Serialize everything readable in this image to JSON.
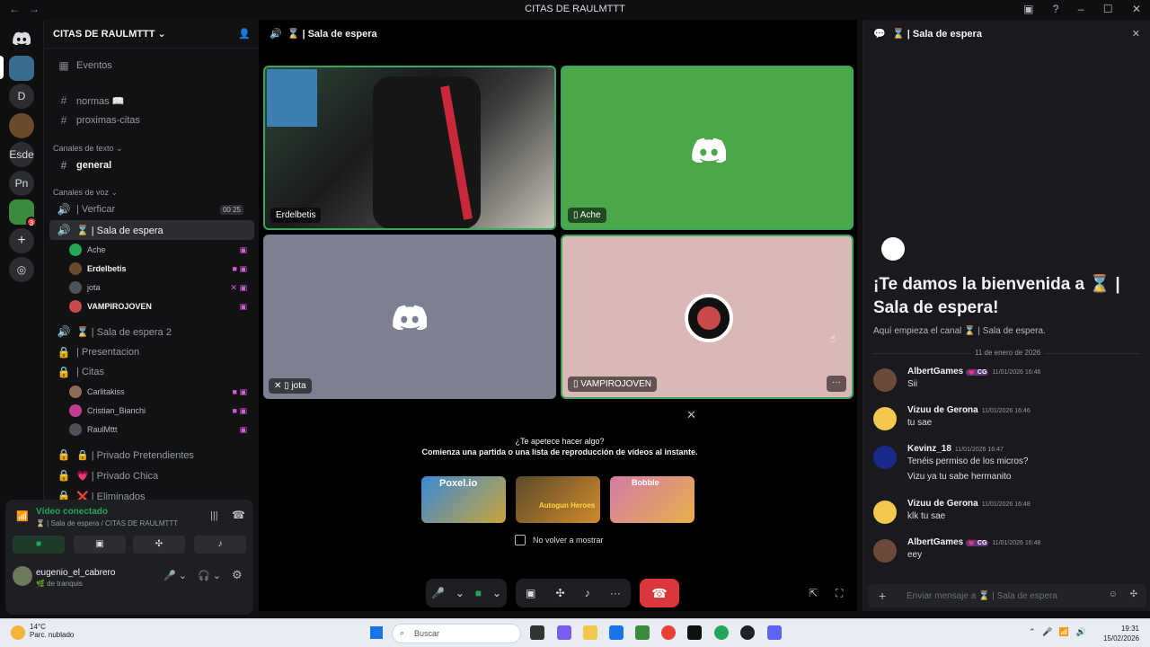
{
  "window": {
    "title": "CITAS DE RAULMTTT",
    "help": "?",
    "minimize": "–",
    "maximize": "☐",
    "close": "✕",
    "back": "←",
    "forward": "→"
  },
  "rail": {
    "servers": [
      "D",
      "Esde",
      "Pn"
    ],
    "badge": "3"
  },
  "server": {
    "name": "CITAS DE RAULMTTT ⌄"
  },
  "sidebar": {
    "events": "Eventos",
    "text_channels": [
      {
        "name": "normas 📖"
      },
      {
        "name": "proximas-citas"
      }
    ],
    "category_text": "Canales de texto ⌄",
    "general": "general",
    "category_voice": "Canales de voz ⌄",
    "voice_channels": [
      {
        "name": "| Verficar",
        "counter": "00  25"
      },
      {
        "name": "⌛ | Sala de espera"
      },
      {
        "name": "⌛ | Sala de espera 2"
      },
      {
        "name": "| Presentacion"
      },
      {
        "name": "| Citas"
      },
      {
        "name": "🔒 | Privado Pretendientes"
      },
      {
        "name": "💗 | Privado Chica"
      },
      {
        "name": "❌ | Eliminados"
      }
    ],
    "users_sala": [
      "Ache",
      "Erdelbetis",
      "jota",
      "VAMPIROJOVEN"
    ],
    "users_citas": [
      "Carlitakiss",
      "Cristian_Bianchi",
      "RaulMttt"
    ]
  },
  "voice_panel": {
    "status": "Vídeo conectado",
    "channel": "⌛ | Sala de espera / CITAS DE RAULMTTT",
    "username": "eugenio_el_cabrero",
    "user_status": "🌿 de tranquis"
  },
  "main": {
    "header": "⌛ | Sala de espera",
    "tiles": [
      "Erdelbetis",
      "Ache",
      "jota",
      "VAMPIROJOVEN"
    ],
    "activity_prompt": "¿Te apetece hacer algo?",
    "activity_desc": "Comienza una partida o una lista de reproducción de vídeos al instante.",
    "games": [
      "Poxel.io",
      "Autogun Heroes",
      "Bobble"
    ],
    "no_show": "No volver a mostrar",
    "close": "✕"
  },
  "chat": {
    "header": "⌛ | Sala de espera",
    "welcome": "¡Te damos la bienvenida a ⌛ | Sala de espera!",
    "welcome_sub": "Aquí empieza el canal ⌛ | Sala de espera.",
    "date_divider": "11 de enero de 2026",
    "messages": [
      {
        "author": "AlbertGames",
        "tag": "💗 CG",
        "time": "11/01/2026 16:46",
        "lines": [
          "Sii"
        ]
      },
      {
        "author": "Vizuu de Gerona",
        "tag": "",
        "time": "11/01/2026 16:46",
        "lines": [
          "tu sae"
        ]
      },
      {
        "author": "Kevinz_18",
        "tag": "",
        "time": "11/01/2026 16:47",
        "lines": [
          "Tenéis permiso de los micros?",
          "Vizu ya tu sabe hermanito"
        ]
      },
      {
        "author": "Vizuu de Gerona",
        "tag": "",
        "time": "11/01/2026 16:48",
        "lines": [
          "klk tu sae"
        ]
      },
      {
        "author": "AlbertGames",
        "tag": "💗 CG",
        "time": "11/01/2026 16:48",
        "lines": [
          "eey"
        ]
      }
    ],
    "input_placeholder": "Enviar mensaje a ⌛ | Sala de espera",
    "close": "✕"
  },
  "taskbar": {
    "temp": "14°C",
    "weather": "Parc. nublado",
    "search": "Buscar",
    "time": "19:31",
    "date": "15/02/2026"
  },
  "colors": {
    "green_tile": "#4aa84b",
    "gray_tile": "#7d8091",
    "pink_tile": "#d9b8b6",
    "accent": "#5865f2",
    "hangup": "#da373c"
  }
}
